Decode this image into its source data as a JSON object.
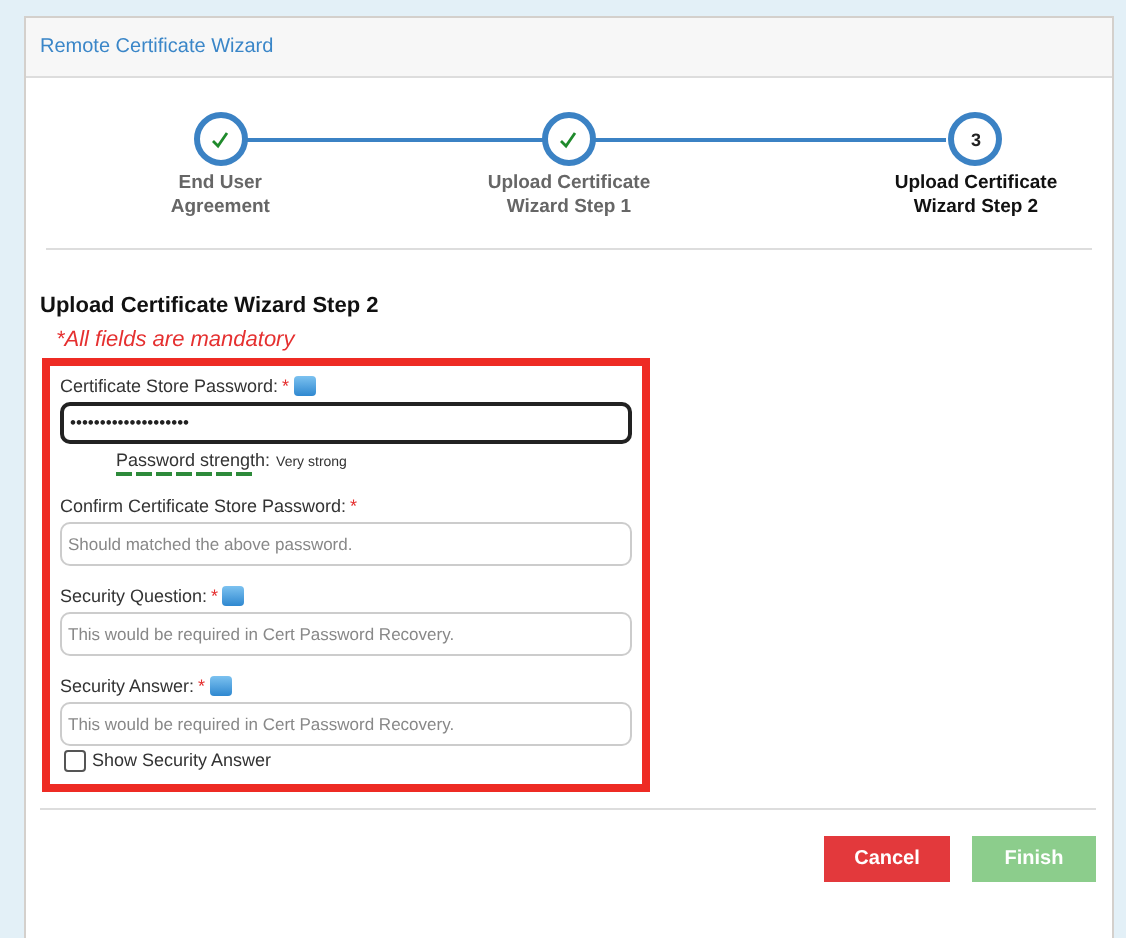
{
  "window": {
    "title": "Remote Certificate Wizard"
  },
  "steps": [
    {
      "label": "End User Agreement",
      "completed": true,
      "current": false
    },
    {
      "label": "Upload Certificate Wizard Step 1",
      "completed": true,
      "current": false
    },
    {
      "label": "Upload Certificate Wizard Step 2",
      "number": "3",
      "completed": false,
      "current": true
    }
  ],
  "form": {
    "title": "Upload Certificate Wizard Step 2",
    "note": "*All fields are mandatory",
    "fields": [
      {
        "kind": "password",
        "label": "Certificate Store Password:",
        "required_mark": "*",
        "help": true,
        "value": "••••••••••••••••••••",
        "focused": true,
        "strength": {
          "label": "Password strength:",
          "reading": "Very strong"
        }
      },
      {
        "kind": "text",
        "label": "Confirm Certificate Store Password:",
        "required_mark": "*",
        "help": false,
        "placeholder": "Should matched the above password.",
        "focused": false
      },
      {
        "kind": "text",
        "label": "Security Question:",
        "required_mark": "*",
        "help": true,
        "placeholder": "This would be required in Cert Password Recovery.",
        "focused": false
      },
      {
        "kind": "text",
        "label": "Security Answer:",
        "required_mark": "*",
        "help": true,
        "placeholder": "This would be required in Cert Password Recovery.",
        "focused": false
      }
    ],
    "show_answer": {
      "label": "Show Security Answer",
      "checked": false
    }
  },
  "buttons": [
    {
      "label": "Cancel",
      "kind": "danger",
      "disabled": false
    },
    {
      "label": "Finish",
      "kind": "success",
      "disabled": true
    }
  ]
}
